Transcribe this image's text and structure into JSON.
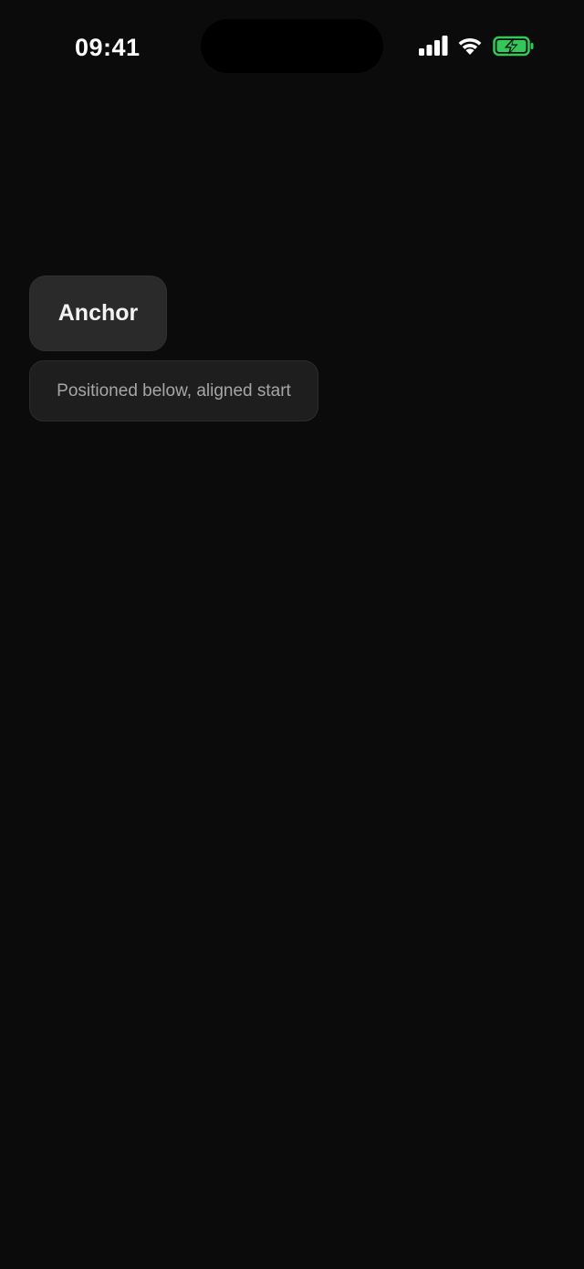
{
  "status_bar": {
    "time": "09:41",
    "icons": [
      "cellular-signal-icon",
      "wifi-icon",
      "battery-charging-icon"
    ],
    "battery_color": "#34c759"
  },
  "main": {
    "anchor_label": "Anchor",
    "popover_text": "Positioned below, aligned start"
  }
}
